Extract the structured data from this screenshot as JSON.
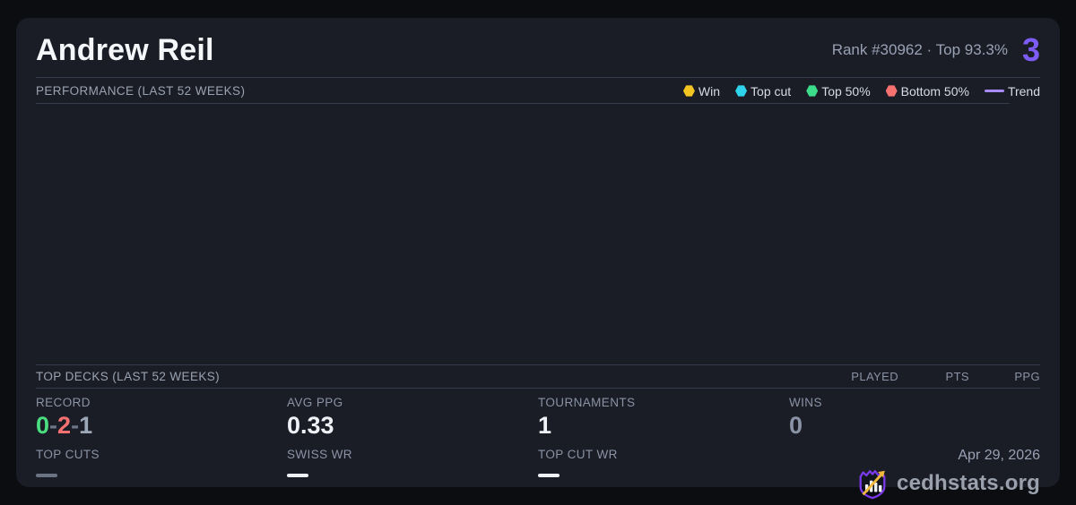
{
  "player": {
    "name": "Andrew Reil",
    "rank_line": "Rank #30962  ·  Top 93.3%",
    "score_badge": "3"
  },
  "performance": {
    "title": "PERFORMANCE (LAST 52 WEEKS)",
    "legend": [
      {
        "label": "Win",
        "color": "#f2c522",
        "type": "dot"
      },
      {
        "label": "Top cut",
        "color": "#2fd4ec",
        "type": "dot"
      },
      {
        "label": "Top 50%",
        "color": "#3ddc8b",
        "type": "dot"
      },
      {
        "label": "Bottom 50%",
        "color": "#f87171",
        "type": "dot"
      },
      {
        "label": "Trend",
        "color": "#a78bfa",
        "type": "line"
      }
    ]
  },
  "top_decks": {
    "title": "TOP DECKS (LAST 52 WEEKS)",
    "columns": [
      "PLAYED",
      "PTS",
      "PPG"
    ]
  },
  "stats": {
    "record": {
      "label": "RECORD",
      "wins": "0",
      "losses": "2",
      "draws": "1",
      "separator": "-"
    },
    "avg_ppg": {
      "label": "AVG PPG",
      "value": "0.33"
    },
    "tournaments": {
      "label": "TOURNAMENTS",
      "value": "1"
    },
    "wins": {
      "label": "WINS",
      "value": "0"
    },
    "top_cuts": {
      "label": "TOP CUTS",
      "value": "—"
    },
    "swiss_wr": {
      "label": "SWISS WR",
      "value": "—"
    },
    "top_cut_wr": {
      "label": "TOP CUT WR",
      "value": "—"
    }
  },
  "footer": {
    "date": "Apr 29, 2026",
    "brand": "cedhstats.org"
  },
  "colors": {
    "accent_purple": "#7d5cf5",
    "record_win": "#4ade80",
    "record_loss": "#f87171",
    "record_draw": "#9ca7b8",
    "divider": "#353b4b",
    "brand_purple": "#7c3aed",
    "arrow_gold": "#f3b93a"
  }
}
